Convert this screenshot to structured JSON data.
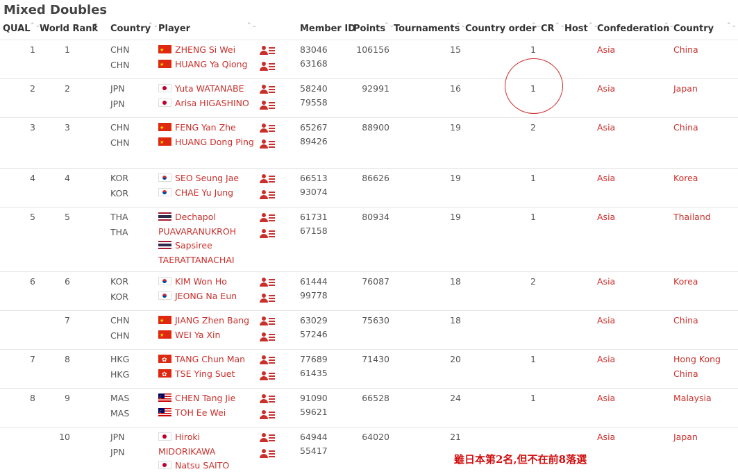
{
  "title": "Mixed Doubles",
  "headers": [
    "QUAL",
    "World Rank",
    "Country",
    "Player",
    "Member ID",
    "Points",
    "Tournaments",
    "Country order",
    "CR",
    "Host",
    "Confederation",
    "Country"
  ],
  "rows": [
    {
      "qual": "1",
      "rank": "1",
      "cc": [
        "CHN",
        "CHN"
      ],
      "players": [
        "ZHENG Si Wei",
        "HUANG Ya Qiong"
      ],
      "flags": [
        "chn",
        "chn"
      ],
      "ids": [
        "83046",
        "63168"
      ],
      "points": "106156",
      "tournaments": "15",
      "cr": "1",
      "confed": "Asia",
      "country": "China"
    },
    {
      "qual": "2",
      "rank": "2",
      "cc": [
        "JPN",
        "JPN"
      ],
      "players": [
        "Yuta WATANABE",
        "Arisa HIGASHINO"
      ],
      "flags": [
        "jpn",
        "jpn"
      ],
      "ids": [
        "58240",
        "79558"
      ],
      "points": "92991",
      "tournaments": "16",
      "cr": "1",
      "confed": "Asia",
      "country": "Japan"
    },
    {
      "qual": "3",
      "rank": "3",
      "cc": [
        "CHN",
        "CHN"
      ],
      "players": [
        "FENG Yan Zhe",
        "HUANG Dong Ping"
      ],
      "flags": [
        "chn",
        "chn"
      ],
      "ids": [
        "65267",
        "89426"
      ],
      "points": "88900",
      "tournaments": "19",
      "cr": "2",
      "confed": "Asia",
      "country": "China"
    },
    {
      "qual": "4",
      "rank": "4",
      "cc": [
        "KOR",
        "KOR"
      ],
      "players": [
        "SEO Seung Jae",
        "CHAE Yu Jung"
      ],
      "flags": [
        "kor",
        "kor"
      ],
      "ids": [
        "66513",
        "93074"
      ],
      "points": "86626",
      "tournaments": "19",
      "cr": "1",
      "confed": "Asia",
      "country": "Korea"
    },
    {
      "qual": "5",
      "rank": "5",
      "cc": [
        "THA",
        "THA"
      ],
      "players": [
        "Dechapol PUAVARANUKROH",
        "Sapsiree TAERATTANACHAI"
      ],
      "flags": [
        "tha",
        "tha"
      ],
      "ids": [
        "61731",
        "67158"
      ],
      "points": "80934",
      "tournaments": "19",
      "cr": "1",
      "confed": "Asia",
      "country": "Thailand"
    },
    {
      "qual": "6",
      "rank": "6",
      "cc": [
        "KOR",
        "KOR"
      ],
      "players": [
        "KIM Won Ho",
        "JEONG Na Eun"
      ],
      "flags": [
        "kor",
        "kor"
      ],
      "ids": [
        "61444",
        "99778"
      ],
      "points": "76087",
      "tournaments": "18",
      "cr": "2",
      "confed": "Asia",
      "country": "Korea"
    },
    {
      "qual": "",
      "rank": "7",
      "cc": [
        "CHN",
        "CHN"
      ],
      "players": [
        "JIANG Zhen Bang",
        "WEI Ya Xin"
      ],
      "flags": [
        "chn",
        "chn"
      ],
      "ids": [
        "63029",
        "57246"
      ],
      "points": "75630",
      "tournaments": "18",
      "cr": "",
      "confed": "Asia",
      "country": "China"
    },
    {
      "qual": "7",
      "rank": "8",
      "cc": [
        "HKG",
        "HKG"
      ],
      "players": [
        "TANG Chun Man",
        "TSE Ying Suet"
      ],
      "flags": [
        "hkg",
        "hkg"
      ],
      "ids": [
        "77689",
        "61435"
      ],
      "points": "71430",
      "tournaments": "20",
      "cr": "1",
      "confed": "Asia",
      "country": "Hong Kong China"
    },
    {
      "qual": "8",
      "rank": "9",
      "cc": [
        "MAS",
        "MAS"
      ],
      "players": [
        "CHEN Tang Jie",
        "TOH Ee Wei"
      ],
      "flags": [
        "mas",
        "mas"
      ],
      "ids": [
        "91090",
        "59621"
      ],
      "points": "66528",
      "tournaments": "24",
      "cr": "1",
      "confed": "Asia",
      "country": "Malaysia"
    },
    {
      "qual": "",
      "rank": "10",
      "cc": [
        "JPN",
        "JPN"
      ],
      "players": [
        "Hiroki MIDORIKAWA",
        "Natsu SAITO"
      ],
      "flags": [
        "jpn",
        "jpn"
      ],
      "ids": [
        "64944",
        "55417"
      ],
      "points": "64020",
      "tournaments": "21",
      "cr": "",
      "confed": "Asia",
      "country": "Japan"
    }
  ],
  "annotation": "雖日本第2名,但不在前8落選",
  "colors": {
    "link": "#c9302c",
    "annotation": "#d01010",
    "circle": "#cc2a2a"
  }
}
